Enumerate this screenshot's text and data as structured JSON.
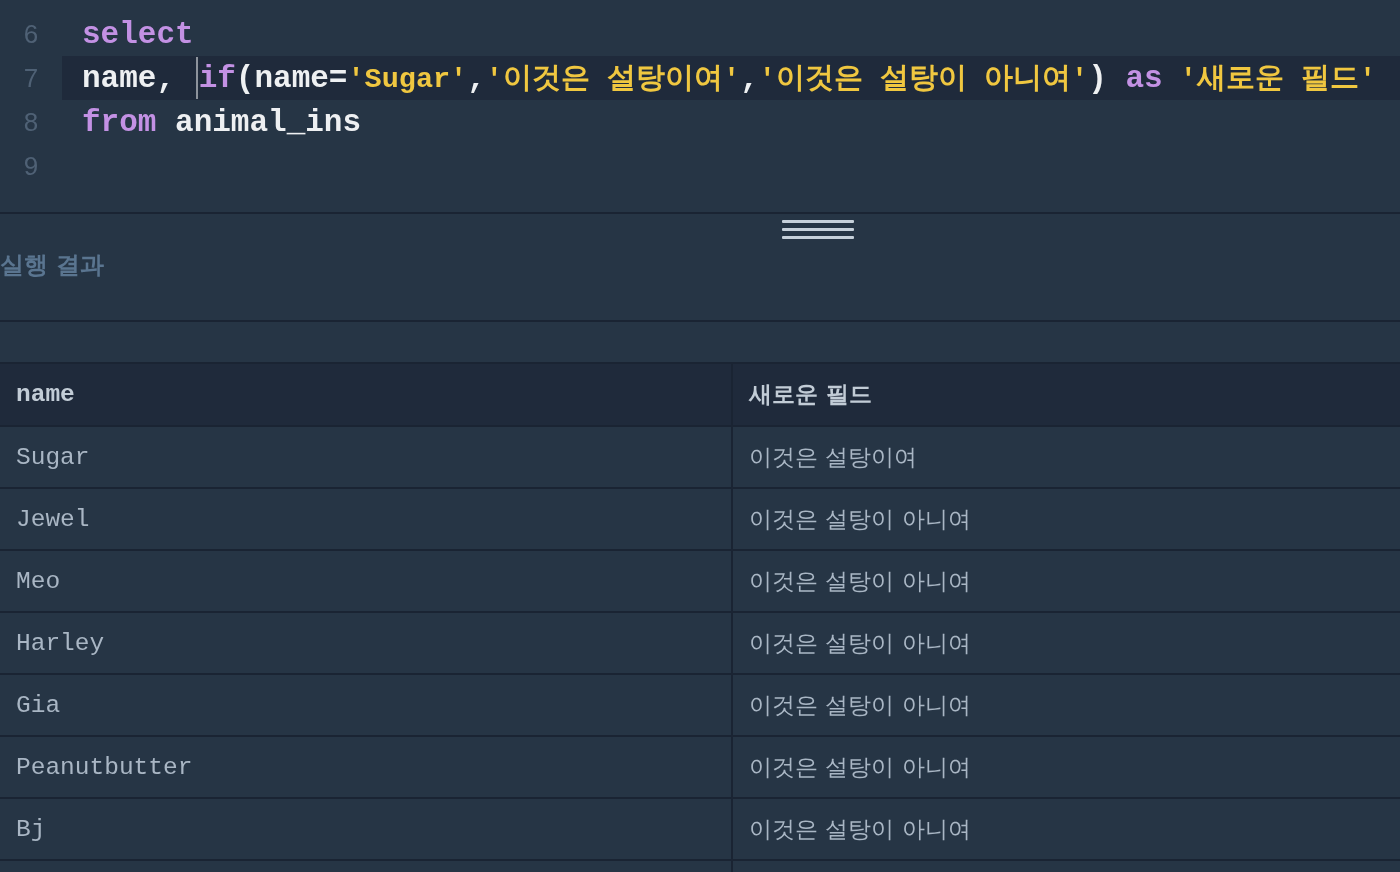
{
  "editor": {
    "lines": [
      {
        "number": "6",
        "tokens": [
          {
            "kind": "keyword",
            "text": "select"
          }
        ]
      },
      {
        "number": "7",
        "tokens": [
          {
            "kind": "plain",
            "text": "name, "
          },
          {
            "kind": "caret"
          },
          {
            "kind": "keyword",
            "text": "if"
          },
          {
            "kind": "plain",
            "text": "(name="
          },
          {
            "kind": "string",
            "text": "'Sugar'"
          },
          {
            "kind": "plain",
            "text": ","
          },
          {
            "kind": "string",
            "text": "'이것은 설탕이여'"
          },
          {
            "kind": "plain",
            "text": ","
          },
          {
            "kind": "string",
            "text": "'이것은 설탕이 아니여'"
          },
          {
            "kind": "plain",
            "text": ") "
          },
          {
            "kind": "keyword",
            "text": "as"
          },
          {
            "kind": "string",
            "text": " '새로운 필드'"
          }
        ]
      },
      {
        "number": "8",
        "tokens": [
          {
            "kind": "keyword",
            "text": "from"
          },
          {
            "kind": "plain",
            "text": " animal_ins"
          }
        ]
      },
      {
        "number": "9"
      }
    ]
  },
  "results": {
    "title": "실행 결과",
    "columns": [
      "name",
      "새로운 필드"
    ],
    "rows": [
      [
        "Sugar",
        "이것은 설탕이여"
      ],
      [
        "Jewel",
        "이것은 설탕이 아니여"
      ],
      [
        "Meo",
        "이것은 설탕이 아니여"
      ],
      [
        "Harley",
        "이것은 설탕이 아니여"
      ],
      [
        "Gia",
        "이것은 설탕이 아니여"
      ],
      [
        "Peanutbutter",
        "이것은 설탕이 아니여"
      ],
      [
        "Bj",
        "이것은 설탕이 아니여"
      ]
    ]
  }
}
